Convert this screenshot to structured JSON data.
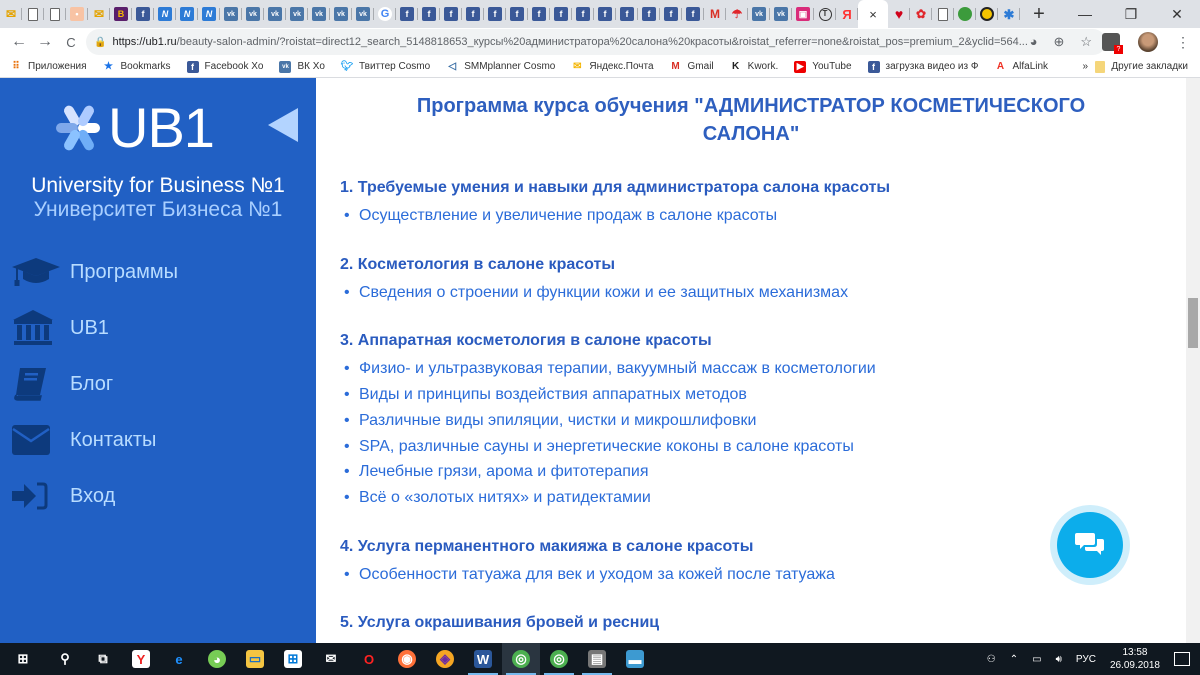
{
  "browser": {
    "tabs": [
      {
        "icon": "yandex-mail-icon"
      },
      {
        "icon": "document-icon"
      },
      {
        "icon": "document-icon"
      },
      {
        "icon": "orange-app-icon"
      },
      {
        "icon": "yandex-mail-icon"
      },
      {
        "icon": "b-icon"
      },
      {
        "icon": "facebook-icon"
      },
      {
        "icon": "n-icon"
      },
      {
        "icon": "n-icon"
      },
      {
        "icon": "n-icon"
      },
      {
        "icon": "vk-icon"
      },
      {
        "icon": "vk-icon"
      },
      {
        "icon": "vk-icon"
      },
      {
        "icon": "vk-icon"
      },
      {
        "icon": "vk-icon"
      },
      {
        "icon": "vk-icon"
      },
      {
        "icon": "vk-icon"
      },
      {
        "icon": "google-icon"
      },
      {
        "icon": "facebook-icon"
      },
      {
        "icon": "facebook-icon"
      },
      {
        "icon": "facebook-icon"
      },
      {
        "icon": "facebook-icon"
      },
      {
        "icon": "facebook-icon"
      },
      {
        "icon": "facebook-icon"
      },
      {
        "icon": "facebook-icon"
      },
      {
        "icon": "facebook-icon"
      },
      {
        "icon": "facebook-icon"
      },
      {
        "icon": "facebook-icon"
      },
      {
        "icon": "facebook-icon"
      },
      {
        "icon": "facebook-icon"
      },
      {
        "icon": "facebook-icon"
      },
      {
        "icon": "facebook-icon"
      },
      {
        "icon": "gmail-icon"
      },
      {
        "icon": "umbrella-icon"
      },
      {
        "icon": "vk-icon"
      },
      {
        "icon": "vk-icon"
      },
      {
        "icon": "pink-app-icon"
      },
      {
        "icon": "t-circle-icon"
      },
      {
        "icon": "yandex-icon"
      }
    ],
    "active_tab_close": "×",
    "tabs_after": [
      {
        "icon": "heart-icon"
      },
      {
        "icon": "flower-icon"
      },
      {
        "icon": "bird-icon"
      },
      {
        "icon": "apple-icon"
      },
      {
        "icon": "beeline-icon"
      },
      {
        "icon": "ub1-icon"
      }
    ],
    "new_tab": "+",
    "window_controls": {
      "minimize": "—",
      "maximize": "❐",
      "close": "✕"
    },
    "nav": {
      "back": "←",
      "forward": "→",
      "reload": "C"
    },
    "url_host": "https://ub1.ru",
    "url_rest": "/beauty-salon-admin/?roistat=direct12_search_5148818653_курсы%20администратора%20салона%20красоты&roistat_referrer=none&roistat_pos=premium_2&yclid=564...",
    "bookmarks": [
      {
        "label": "Приложения",
        "icon": "apps-icon"
      },
      {
        "label": "Bookmarks",
        "icon": "star-icon"
      },
      {
        "label": "Facebook Xo",
        "icon": "facebook-icon"
      },
      {
        "label": "ВК Xo",
        "icon": "vk-icon"
      },
      {
        "label": "Твиттер Cosmo",
        "icon": "twitter-icon"
      },
      {
        "label": "SMMplanner Cosmo",
        "icon": "smmplanner-icon"
      },
      {
        "label": "Яндекс.Почта",
        "icon": "yandex-mail-icon"
      },
      {
        "label": "Gmail",
        "icon": "gmail-icon"
      },
      {
        "label": "Kwork.",
        "icon": "kwork-icon"
      },
      {
        "label": "YouTube",
        "icon": "youtube-icon"
      },
      {
        "label": "загрузка видео из Ф",
        "icon": "facebook-icon"
      },
      {
        "label": "AlfaLink",
        "icon": "alfa-icon"
      }
    ],
    "bookmarks_more": "»",
    "other_bookmarks": "Другие закладки"
  },
  "sidebar": {
    "logo_text": "UB1",
    "tagline_en": "University for Business №1",
    "tagline_ru": "Университет Бизнеса №1",
    "nav": [
      {
        "label": "Программы",
        "icon": "graduation-cap-icon"
      },
      {
        "label": "UB1",
        "icon": "university-icon"
      },
      {
        "label": "Блог",
        "icon": "book-icon"
      },
      {
        "label": "Контакты",
        "icon": "envelope-icon"
      },
      {
        "label": "Вход",
        "icon": "sign-in-icon"
      }
    ]
  },
  "content": {
    "title": "Программа курса обучения \"АДМИНИСТРАТОР КОСМЕТИЧЕСКОГО САЛОНА\"",
    "sections": [
      {
        "title": "1. Требуемые умения и навыки для администратора салона красоты",
        "items": [
          "Осуществление и увеличение продаж в салоне красоты"
        ]
      },
      {
        "title": "2. Косметология в салоне красоты",
        "items": [
          "Сведения о строении и функции кожи и ее защитных механизмах"
        ]
      },
      {
        "title": "3. Аппаратная косметология в салоне красоты",
        "items": [
          "Физио- и ультразвуковая терапии, вакуумный массаж в косметологии",
          "Виды и принципы воздействия аппаратных методов",
          "Различные виды эпиляции, чистки и микрошлифовки",
          "SPA, различные сауны и энергетические коконы в салоне красоты",
          "Лечебные грязи, арома и фитотерапия",
          "Всё о «золотых нитях» и ратидектамии"
        ]
      },
      {
        "title": "4. Услуга перманентного макияжа в салоне красоты",
        "items": [
          "Особенности татуажа для век и уходом за кожей после татуажа"
        ]
      },
      {
        "title": "5. Услуга окрашивания бровей и ресниц",
        "items": []
      }
    ]
  },
  "colors": {
    "sidebar_bg": "#2160c4",
    "heading": "#2a5bbf",
    "list_text": "#2b6cd9",
    "chat_button": "#0cadeb"
  },
  "taskbar": {
    "apps": [
      "windows-start-icon",
      "search-icon",
      "task-view-icon",
      "yandex-browser-icon",
      "edge-icon",
      "picasa-icon",
      "file-explorer-icon",
      "store-icon",
      "mail-icon",
      "opera-icon",
      "firefox-icon",
      "tor-icon",
      "word-icon",
      "chrome-icon",
      "chrome-icon",
      "network-app-icon",
      "photos-icon"
    ],
    "language": "РУС",
    "time": "13:58",
    "date": "26.09.2018"
  }
}
